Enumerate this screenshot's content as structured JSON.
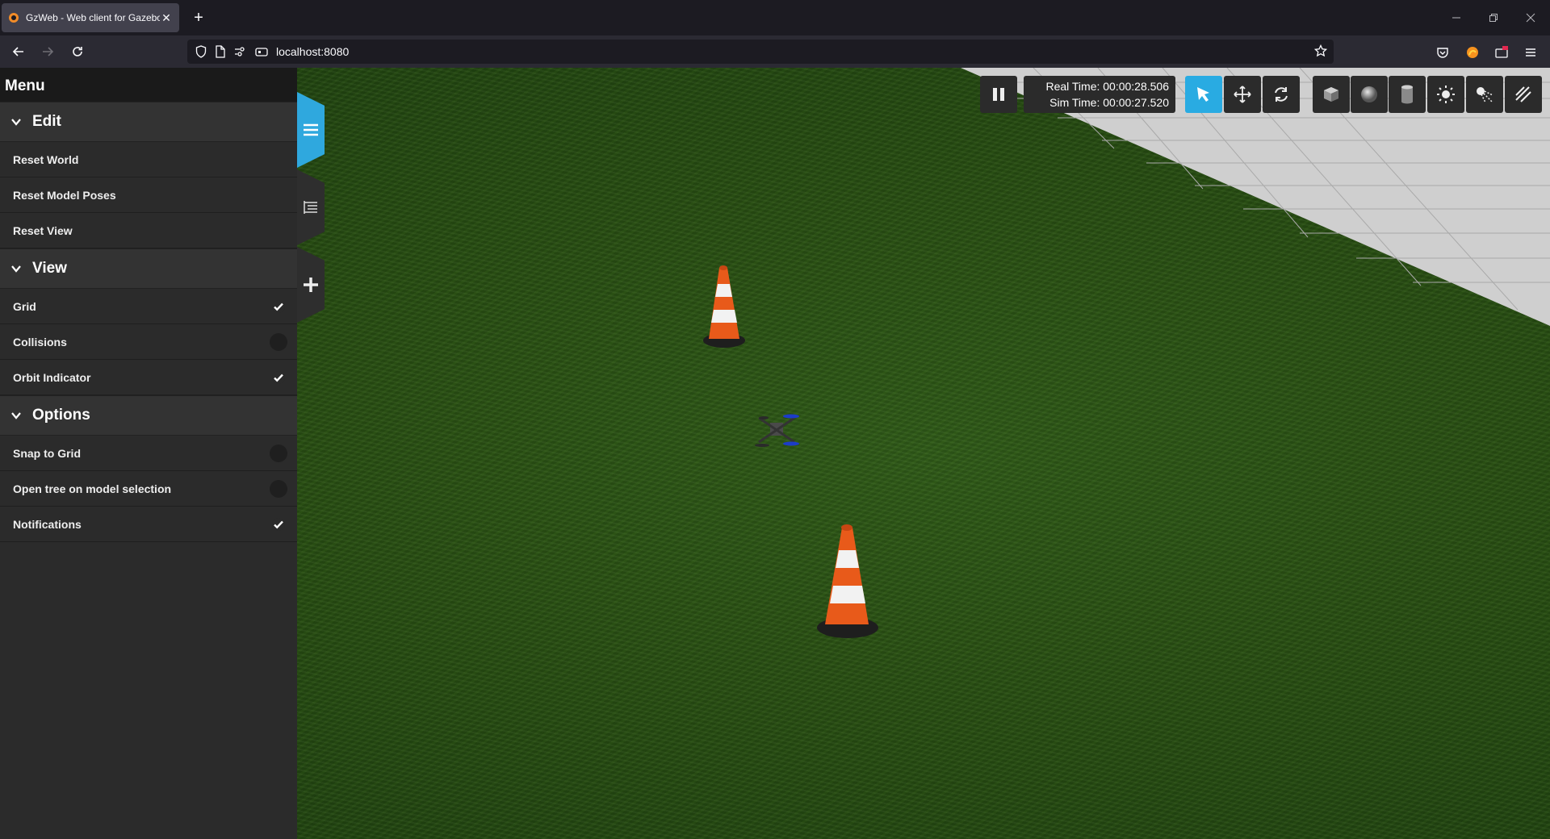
{
  "browser": {
    "tab_title": "GzWeb - Web client for Gazebo",
    "url": "localhost:8080"
  },
  "sidebar": {
    "title": "Menu",
    "sections": [
      {
        "title": "Edit",
        "items": [
          {
            "label": "Reset World"
          },
          {
            "label": "Reset Model Poses"
          },
          {
            "label": "Reset View"
          }
        ]
      },
      {
        "title": "View",
        "items": [
          {
            "label": "Grid",
            "checked": true
          },
          {
            "label": "Collisions",
            "checked": false
          },
          {
            "label": "Orbit Indicator",
            "checked": true
          }
        ]
      },
      {
        "title": "Options",
        "items": [
          {
            "label": "Snap to Grid",
            "checked": false
          },
          {
            "label": "Open tree on model selection",
            "checked": false
          },
          {
            "label": "Notifications",
            "checked": true
          }
        ]
      }
    ]
  },
  "toolbar": {
    "real_time": "Real Time: 00:00:28.506",
    "sim_time": "Sim Time: 00:00:27.520",
    "active_mode": "select",
    "accent_color": "#29abe2"
  }
}
